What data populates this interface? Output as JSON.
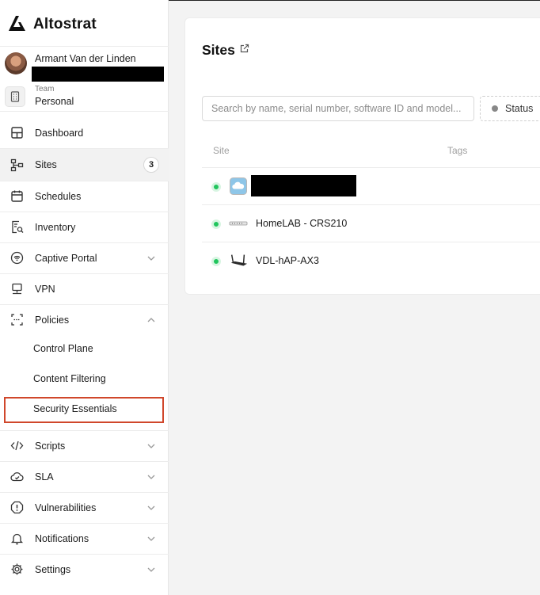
{
  "brand": {
    "name": "Altostrat"
  },
  "user": {
    "name": "Armant Van der Linden"
  },
  "team": {
    "label": "Team",
    "value": "Personal"
  },
  "nav": {
    "dashboard": "Dashboard",
    "sites": "Sites",
    "sites_count": "3",
    "schedules": "Schedules",
    "inventory": "Inventory",
    "captive_portal": "Captive Portal",
    "vpn": "VPN",
    "policies": "Policies",
    "policies_children": [
      "Control Plane",
      "Content Filtering",
      "Security Essentials"
    ],
    "scripts": "Scripts",
    "sla": "SLA",
    "vulnerabilities": "Vulnerabilities",
    "notifications": "Notifications",
    "settings": "Settings"
  },
  "main": {
    "title": "Sites",
    "search_placeholder": "Search by name, serial number, software ID and model...",
    "status_filter": "Status",
    "columns": {
      "site": "Site",
      "tags": "Tags"
    },
    "rows": [
      {
        "name": "",
        "icon": "cloud-icon",
        "status": "online"
      },
      {
        "name": "HomeLAB - CRS210",
        "icon": "switch-icon",
        "status": "online"
      },
      {
        "name": "VDL-hAP-AX3",
        "icon": "router-icon",
        "status": "online"
      }
    ]
  },
  "colors": {
    "online": "#21c55d",
    "highlight_border": "#d0472b"
  }
}
